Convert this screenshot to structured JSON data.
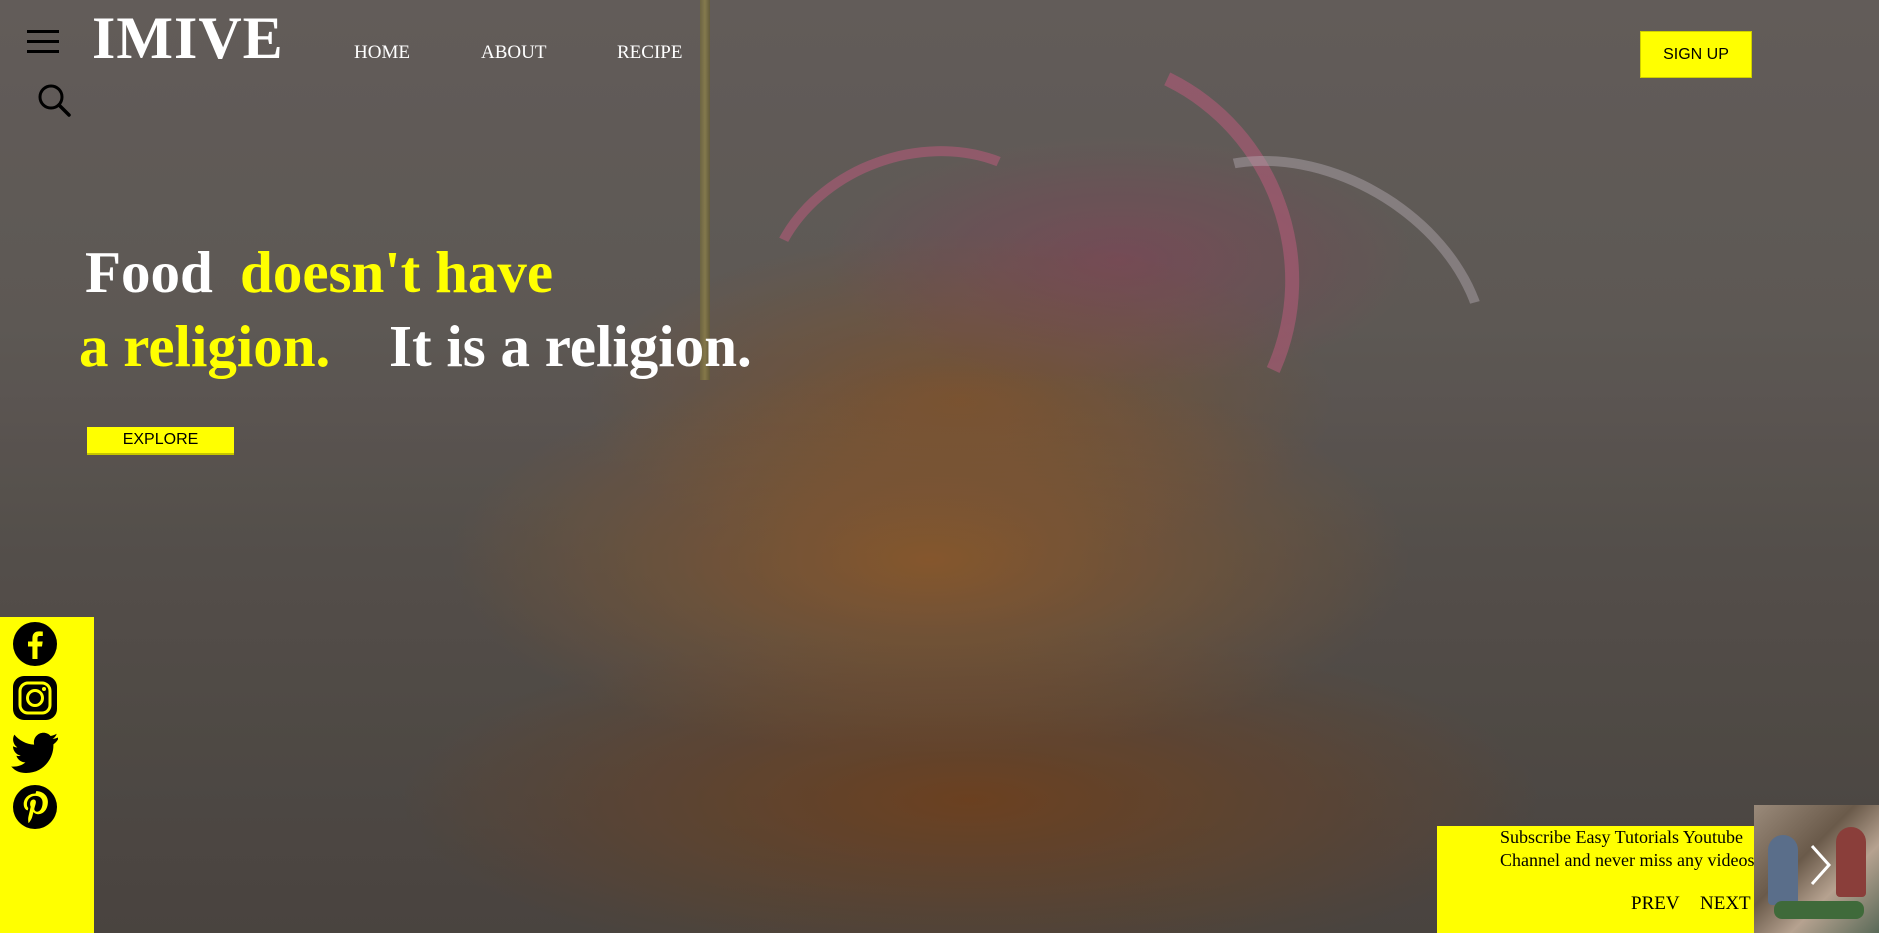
{
  "brand": {
    "logo": "IMIVE"
  },
  "nav": {
    "home": "HOME",
    "about": "ABOUT",
    "recipe": "RECIPE"
  },
  "header": {
    "signup_label": "SIGN UP"
  },
  "hero": {
    "line1_white": "Food",
    "line1_yellow": "doesn't have",
    "line2_yellow": "a religion.",
    "line2_white": "It is a religion.",
    "explore_label": "EXPLORE"
  },
  "icons": {
    "menu": "hamburger-menu-icon",
    "search": "search-icon",
    "social": [
      "facebook-icon",
      "instagram-icon",
      "twitter-icon",
      "pinterest-icon"
    ],
    "slider_arrow": "chevron-right-icon"
  },
  "promo": {
    "text": "Subscribe Easy Tutorials Youtube Channel and never miss any videos.",
    "prev_label": "PREV",
    "next_label": "NEXT"
  },
  "colors": {
    "accent": "#ffff00",
    "text_light": "#ffffff",
    "text_dark": "#000000"
  }
}
